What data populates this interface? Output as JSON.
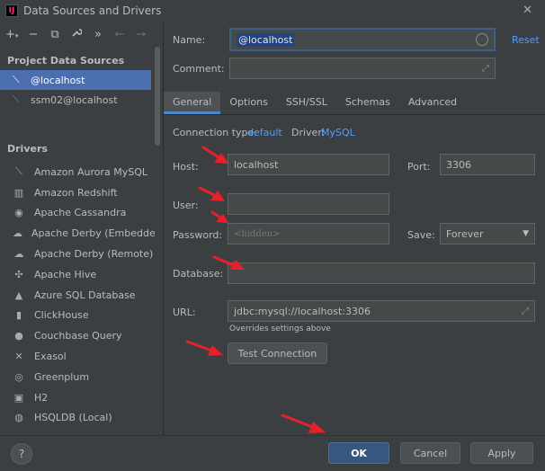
{
  "window": {
    "title": "Data Sources and Drivers"
  },
  "toolbar": {
    "add": "+",
    "add_caret": "▾",
    "remove": "−",
    "copy": "⧉",
    "wrench": "🔧",
    "more": "»",
    "back": "←",
    "forward": "→"
  },
  "sidebar": {
    "project_header": "Project Data Sources",
    "data_sources": [
      {
        "label": "@localhost",
        "selected": true
      },
      {
        "label": "ssm02@localhost",
        "selected": false
      }
    ],
    "drivers_header": "Drivers",
    "drivers": [
      {
        "label": "Amazon Aurora MySQL",
        "icon": "aurora-icon"
      },
      {
        "label": "Amazon Redshift",
        "icon": "redshift-icon"
      },
      {
        "label": "Apache Cassandra",
        "icon": "cassandra-icon"
      },
      {
        "label": "Apache Derby (Embedded)",
        "icon": "derby-icon"
      },
      {
        "label": "Apache Derby (Remote)",
        "icon": "derby-icon"
      },
      {
        "label": "Apache Hive",
        "icon": "hive-icon"
      },
      {
        "label": "Azure SQL Database",
        "icon": "azure-icon"
      },
      {
        "label": "ClickHouse",
        "icon": "clickhouse-icon"
      },
      {
        "label": "Couchbase Query",
        "icon": "couchbase-icon"
      },
      {
        "label": "Exasol",
        "icon": "exasol-icon"
      },
      {
        "label": "Greenplum",
        "icon": "greenplum-icon"
      },
      {
        "label": "H2",
        "icon": "h2-icon"
      },
      {
        "label": "HSQLDB (Local)",
        "icon": "hsqldb-icon"
      }
    ]
  },
  "form": {
    "name_label": "Name:",
    "name_value": "@localhost",
    "reset_label": "Reset",
    "comment_label": "Comment:",
    "comment_value": "",
    "tabs": [
      "General",
      "Options",
      "SSH/SSL",
      "Schemas",
      "Advanced"
    ],
    "active_tab": "General",
    "connection_type_label": "Connection type:",
    "connection_type_value": "default",
    "driver_label": "Driver:",
    "driver_value": "MySQL",
    "host_label": "Host:",
    "host_value": "localhost",
    "port_label": "Port:",
    "port_value": "3306",
    "user_label": "User:",
    "user_value": "",
    "password_label": "Password:",
    "password_placeholder": "<hidden>",
    "save_label": "Save:",
    "save_value": "Forever",
    "database_label": "Database:",
    "database_value": "",
    "url_label": "URL:",
    "url_value": "jdbc:mysql://localhost:3306",
    "url_hint": "Overrides settings above",
    "test_connection": "Test Connection"
  },
  "footer": {
    "help": "?",
    "ok": "OK",
    "cancel": "Cancel",
    "apply": "Apply"
  },
  "colors": {
    "background": "#3c3f41",
    "selection": "#4b6eaf",
    "link": "#589df6",
    "primary_button": "#365880",
    "arrow": "#e8202a"
  }
}
